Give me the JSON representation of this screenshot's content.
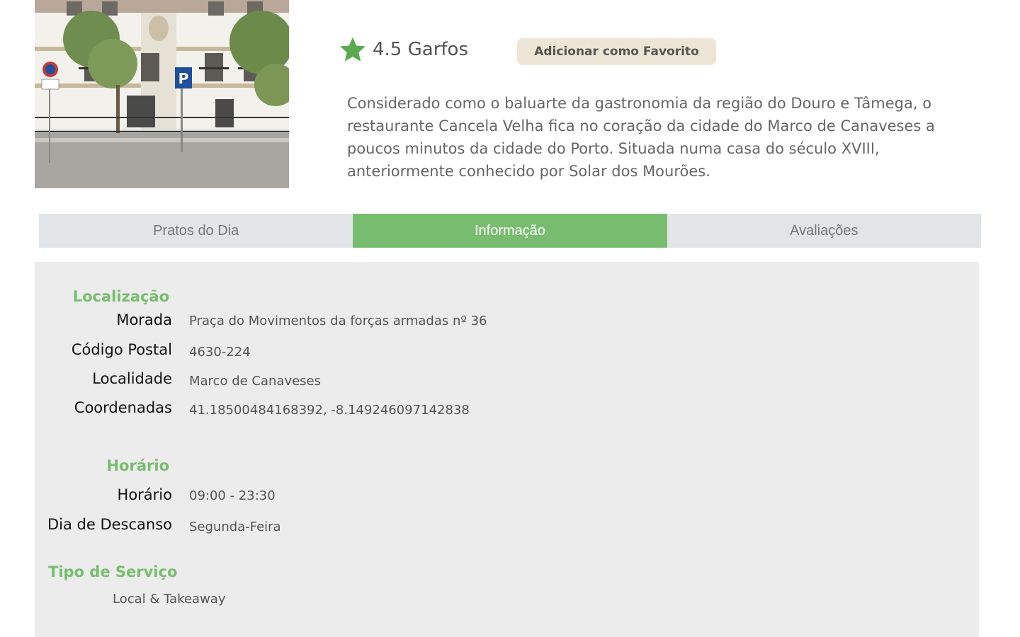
{
  "restaurant": {
    "photo_icon": "restaurant-building-photo",
    "rating_icon": "star-icon",
    "rating_text": "4.5 Garfos",
    "favorite_label": "Adicionar como Favorito",
    "description": "Considerado como o baluarte da gastronomia da região do Douro e Tâmega, o restaurante Cancela Velha fica no coração da cidade do Marco de Canaveses a poucos minutos da cidade do Porto. Situada numa casa do século XVIII, anteriormente conhecido por Solar dos Mourões."
  },
  "tabs": [
    {
      "label": "Pratos do Dia",
      "active": false
    },
    {
      "label": "Informação",
      "active": true
    },
    {
      "label": "Avaliações",
      "active": false
    }
  ],
  "info": {
    "location_title": "Localização",
    "address_label": "Morada",
    "address_value": "Praça do Movimentos da forças armadas nº 36",
    "postal_label": "Código Postal",
    "postal_value": "4630-224",
    "locality_label": "Localidade",
    "locality_value": "Marco de Canaveses",
    "coords_label": "Coordenadas",
    "coords_value": "41.18500484168392, -8.149246097142838",
    "schedule_title": "Horário",
    "hours_label": "Horário",
    "hours_value": "09:00 - 23:30",
    "rest_day_label": "Dia de Descanso",
    "rest_day_value": "Segunda-Feira",
    "service_title": "Tipo de Serviço",
    "service_value": "Local & Takeaway"
  },
  "colors": {
    "accent": "#78bd6f",
    "tab_inactive": "#e2e5e8",
    "panel_bg": "#ececec",
    "favorite_bg": "#ede5d6"
  }
}
